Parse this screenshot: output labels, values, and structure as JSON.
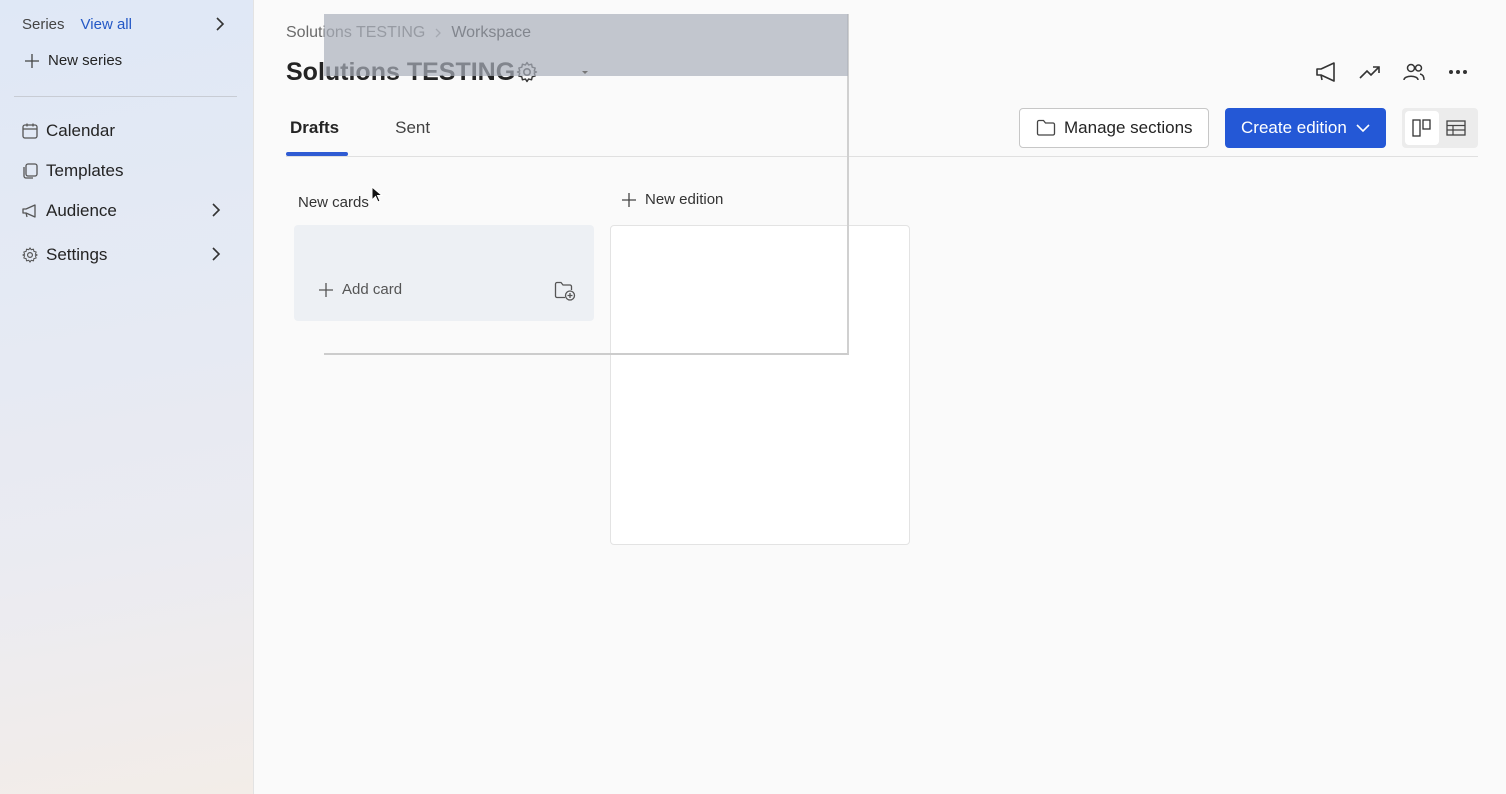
{
  "sidebar": {
    "series_label": "Series",
    "view_all_label": "View all",
    "new_series_label": "New series",
    "items": [
      {
        "label": "Calendar",
        "icon": "calendar-icon"
      },
      {
        "label": "Templates",
        "icon": "templates-icon"
      },
      {
        "label": "Audience",
        "icon": "megaphone-icon"
      },
      {
        "label": "Settings",
        "icon": "gear-icon"
      }
    ]
  },
  "breadcrumb": {
    "parent": "Solutions TESTING",
    "current": "Workspace"
  },
  "page": {
    "title": "Solutions TESTING"
  },
  "tabs": [
    {
      "label": "Drafts",
      "active": true
    },
    {
      "label": "Sent",
      "active": false
    }
  ],
  "toolbar": {
    "manage_sections_label": "Manage sections",
    "create_edition_label": "Create edition"
  },
  "board": {
    "new_cards_label": "New cards",
    "add_card_label": "Add card",
    "new_edition_label": "New edition"
  },
  "colors": {
    "accent": "#2458d6",
    "tab_underline": "#2f5bd3",
    "link": "#2458c6"
  }
}
